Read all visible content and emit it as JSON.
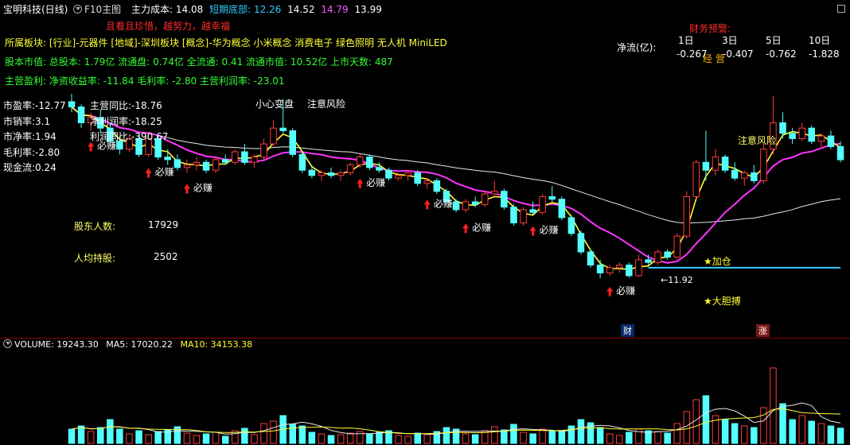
{
  "header": {
    "stock_title": "宝明科技(日线)",
    "f10": "F10主图",
    "zl_label": "主力成本:",
    "zl_value": "14.08",
    "dq_label": "短期底部:",
    "dq_v1": "12.26",
    "dq_v2": "14.52",
    "dq_v3": "14.79",
    "dq_v4": "13.99",
    "motto": "且看且珍惜，越努力，越幸福"
  },
  "finance_warning": {
    "title": "财务预警:",
    "label": "经 营"
  },
  "netflow": {
    "label": "净流(亿):",
    "periods": [
      "1日",
      "3日",
      "5日",
      "10日"
    ],
    "values": [
      "-0.267",
      "-0.407",
      "-0.762",
      "-1.828"
    ]
  },
  "info": {
    "sector": "所属板块: [行业]-元器件 [地域]-深圳板块 [概念]-华为概念 小米概念 消费电子 绿色照明 无人机 MiniLED",
    "shares": "股本市值: 总股本: 1.79亿 流通盘: 0.74亿 全流通: 0.41 流通市值: 10.52亿 上市天数: 487",
    "profit": "主营盈利: 净资收益率: -11.84 毛利率: -2.80 主营利润率: -23.01"
  },
  "ratios_left": [
    {
      "label": "市盈率:",
      "value": "-12.77"
    },
    {
      "label": "市销率:",
      "value": "3.1"
    },
    {
      "label": "市净率:",
      "value": "1.94"
    },
    {
      "label": "毛利率:",
      "value": "-2.80"
    },
    {
      "label": "现金流:",
      "value": "0.24"
    }
  ],
  "ratios_mid": [
    {
      "label": "主营同比:",
      "value": "-18.76"
    },
    {
      "label": "净利润率:",
      "value": "-18.25"
    },
    {
      "label": "利润同比:",
      "value": "-390.67"
    }
  ],
  "holders": {
    "count_label": "股东人数:",
    "count_value": "17929",
    "avg_label": "人均持股:",
    "avg_value": "2502"
  },
  "annotations": {
    "bi_zhuan": "必赚",
    "xiao_xin": "小心变盘",
    "zhu_yi": "注意风险",
    "zhu_yi2": "注意风险",
    "jia_cang": "★加仓",
    "da_dan": "★大胆搏",
    "low_price": "←11.92",
    "tag_cai": "财",
    "tag_zhang": "涨"
  },
  "volume": {
    "label": "VOLUME: 19243.30",
    "ma5": "MA5: 17020.22",
    "ma10": "MA10: 34153.38"
  },
  "colors": {
    "up": "#ff3b3b",
    "down": "#54ffff",
    "ma_white": "#e8e8e8",
    "ma_yellow": "#ffff33",
    "ma_magenta": "#ff33ff",
    "support": "#33ccff"
  },
  "chart_data": {
    "type": "candlestick",
    "price_range": [
      11.0,
      20.5
    ],
    "low_marker": 11.92,
    "candles": [
      [
        18.6,
        18.9,
        18.2,
        18.4
      ],
      [
        18.4,
        18.5,
        17.6,
        17.8
      ],
      [
        17.8,
        18.2,
        17.5,
        18.0
      ],
      [
        18.0,
        18.3,
        17.4,
        17.6
      ],
      [
        17.6,
        17.8,
        16.9,
        17.1
      ],
      [
        17.1,
        17.3,
        16.6,
        16.8
      ],
      [
        16.8,
        17.3,
        16.7,
        17.2
      ],
      [
        17.2,
        17.3,
        16.5,
        16.6
      ],
      [
        16.6,
        17.4,
        16.5,
        17.2
      ],
      [
        17.2,
        17.3,
        16.4,
        16.5
      ],
      [
        16.5,
        16.8,
        16.2,
        16.4
      ],
      [
        16.4,
        16.6,
        16.0,
        16.1
      ],
      [
        16.1,
        16.4,
        15.9,
        16.2
      ],
      [
        16.2,
        16.5,
        16.0,
        16.3
      ],
      [
        16.3,
        16.4,
        15.9,
        16.0
      ],
      [
        16.0,
        16.5,
        15.9,
        16.4
      ],
      [
        16.4,
        16.6,
        16.2,
        16.3
      ],
      [
        16.3,
        16.8,
        16.2,
        16.7
      ],
      [
        16.7,
        17.0,
        16.2,
        16.3
      ],
      [
        16.3,
        16.6,
        16.1,
        16.5
      ],
      [
        16.5,
        17.2,
        16.4,
        17.0
      ],
      [
        17.0,
        17.9,
        16.9,
        17.6
      ],
      [
        17.6,
        18.7,
        17.4,
        17.5
      ],
      [
        17.5,
        17.6,
        16.5,
        16.6
      ],
      [
        16.6,
        16.7,
        15.9,
        16.0
      ],
      [
        16.0,
        16.2,
        15.7,
        15.8
      ],
      [
        15.8,
        16.0,
        15.6,
        15.9
      ],
      [
        15.9,
        16.1,
        15.7,
        15.8
      ],
      [
        15.8,
        16.0,
        15.6,
        15.9
      ],
      [
        15.9,
        16.3,
        15.8,
        16.2
      ],
      [
        16.2,
        16.6,
        16.1,
        16.5
      ],
      [
        16.5,
        16.6,
        16.0,
        16.1
      ],
      [
        16.1,
        16.3,
        15.9,
        16.0
      ],
      [
        16.0,
        16.1,
        15.6,
        15.7
      ],
      [
        15.7,
        15.9,
        15.6,
        15.8
      ],
      [
        15.8,
        16.0,
        15.6,
        15.9
      ],
      [
        15.9,
        16.0,
        15.4,
        15.5
      ],
      [
        15.5,
        15.7,
        15.3,
        15.6
      ],
      [
        15.6,
        15.7,
        15.1,
        15.2
      ],
      [
        15.2,
        15.3,
        14.7,
        14.8
      ],
      [
        14.8,
        14.9,
        14.4,
        14.5
      ],
      [
        14.5,
        14.9,
        14.4,
        14.8
      ],
      [
        14.8,
        15.0,
        14.6,
        14.7
      ],
      [
        14.7,
        15.2,
        14.6,
        15.1
      ],
      [
        15.1,
        15.6,
        15.0,
        15.2
      ],
      [
        15.2,
        15.3,
        14.5,
        14.6
      ],
      [
        14.6,
        14.7,
        13.9,
        14.0
      ],
      [
        14.0,
        14.6,
        13.9,
        14.5
      ],
      [
        14.5,
        14.8,
        14.3,
        14.4
      ],
      [
        14.4,
        15.1,
        14.3,
        15.0
      ],
      [
        15.0,
        15.4,
        14.8,
        14.9
      ],
      [
        14.9,
        15.0,
        14.1,
        14.2
      ],
      [
        14.2,
        14.3,
        13.5,
        13.6
      ],
      [
        13.6,
        13.7,
        12.8,
        12.9
      ],
      [
        12.9,
        13.0,
        12.3,
        12.4
      ],
      [
        12.4,
        12.6,
        11.9,
        12.1
      ],
      [
        12.1,
        12.4,
        12.0,
        12.3
      ],
      [
        12.3,
        12.5,
        12.1,
        12.4
      ],
      [
        12.4,
        12.5,
        11.92,
        12.0
      ],
      [
        12.0,
        12.8,
        11.95,
        12.6
      ],
      [
        12.6,
        12.8,
        12.4,
        12.5
      ],
      [
        12.5,
        13.0,
        12.4,
        12.9
      ],
      [
        12.9,
        13.0,
        12.6,
        12.7
      ],
      [
        12.7,
        13.6,
        12.6,
        13.5
      ],
      [
        13.5,
        15.2,
        13.4,
        15.0
      ],
      [
        15.0,
        16.4,
        14.9,
        16.3
      ],
      [
        16.3,
        17.5,
        15.6,
        16.0
      ],
      [
        16.0,
        16.8,
        15.8,
        16.5
      ],
      [
        16.5,
        16.6,
        15.9,
        16.0
      ],
      [
        16.0,
        16.3,
        15.6,
        15.7
      ],
      [
        15.7,
        16.0,
        15.4,
        15.9
      ],
      [
        15.9,
        16.2,
        15.5,
        15.6
      ],
      [
        15.6,
        17.0,
        15.5,
        16.8
      ],
      [
        16.8,
        18.8,
        16.6,
        17.8
      ],
      [
        17.8,
        18.2,
        17.2,
        17.4
      ],
      [
        17.4,
        17.6,
        17.0,
        17.2
      ],
      [
        17.2,
        17.8,
        17.1,
        17.6
      ],
      [
        17.6,
        17.7,
        17.0,
        17.1
      ],
      [
        17.1,
        17.4,
        16.8,
        17.3
      ],
      [
        17.3,
        17.5,
        16.8,
        16.9
      ],
      [
        16.9,
        17.1,
        16.3,
        16.4
      ]
    ],
    "volume_range": [
      0,
      120000
    ],
    "volumes": [
      18000,
      22000,
      15000,
      20000,
      30000,
      18000,
      12000,
      16000,
      11000,
      15000,
      17000,
      21000,
      13000,
      10000,
      12000,
      14000,
      9000,
      16000,
      19000,
      11000,
      25000,
      28000,
      35000,
      24000,
      22000,
      14000,
      12000,
      10000,
      11000,
      13000,
      15000,
      12000,
      14000,
      16000,
      10000,
      9000,
      13000,
      11000,
      15000,
      20000,
      18000,
      12000,
      11000,
      16000,
      21000,
      17000,
      24000,
      14000,
      12000,
      18000,
      15000,
      16000,
      22000,
      30000,
      26000,
      20000,
      12000,
      10000,
      14000,
      18000,
      16000,
      15000,
      13000,
      25000,
      40000,
      55000,
      60000,
      35000,
      30000,
      25000,
      22000,
      20000,
      45000,
      95000,
      50000,
      30000,
      35000,
      28000,
      25000,
      22000,
      19243
    ]
  }
}
